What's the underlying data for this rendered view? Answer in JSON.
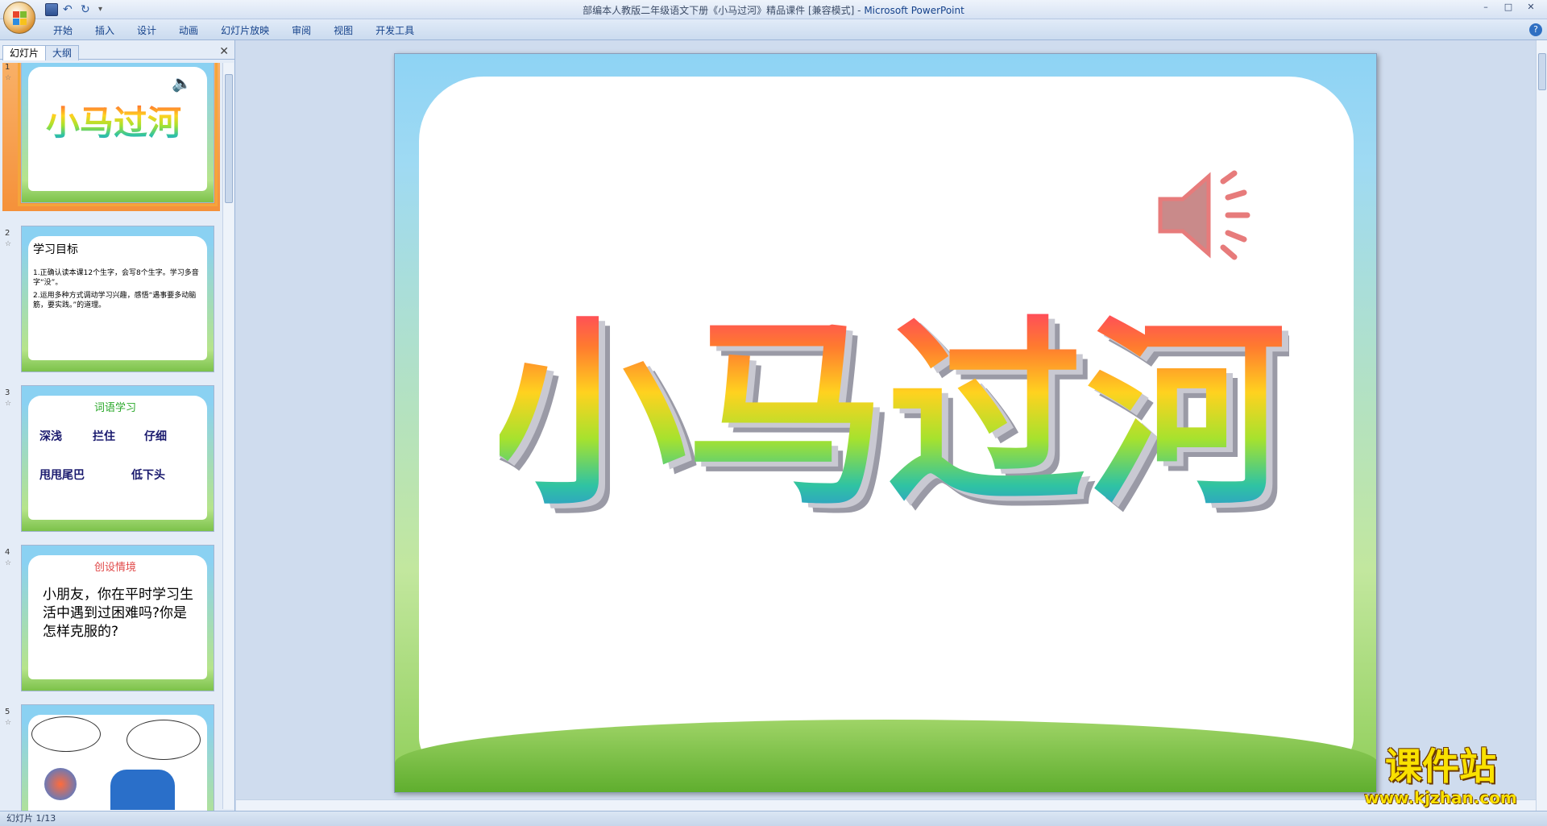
{
  "window": {
    "title": "部编本人教版二年级语文下册《小马过河》精品课件 [兼容模式] - ",
    "app_name": "Microsoft PowerPoint",
    "controls": [
      "–",
      "□",
      "✕"
    ]
  },
  "ribbon": {
    "tabs": [
      "开始",
      "插入",
      "设计",
      "动画",
      "幻灯片放映",
      "审阅",
      "视图",
      "开发工具"
    ],
    "help": "?"
  },
  "left_pane": {
    "tabs": [
      "幻灯片",
      "大纲"
    ],
    "close": "✕",
    "slides": [
      {
        "num": "1",
        "title": "小马过河"
      },
      {
        "num": "2",
        "title": "学习目标",
        "lines": [
          "1.正确认读本课12个生字，会写8个生字。学习多音字“没”。",
          "2.运用多种方式调动学习兴趣，感悟“遇事要多动脑筋，要实践。”的道理。"
        ]
      },
      {
        "num": "3",
        "title": "词语学习",
        "words_row1": [
          "深浅",
          "拦住",
          "仔细"
        ],
        "words_row2": [
          "甩甩尾巴",
          "低下头"
        ]
      },
      {
        "num": "4",
        "title": "创设情境",
        "body": "小朋友，你在平时学习生活中遇到过困难吗?你是怎样克服的?"
      },
      {
        "num": "5"
      }
    ]
  },
  "slide": {
    "title": "小马过河",
    "rainbow_colors": [
      "#ff3b6b",
      "#ff7a2f",
      "#ffd21f",
      "#a6e22e",
      "#2fc3a3",
      "#2f7fe8"
    ]
  },
  "status": {
    "text": "幻灯片 1/13"
  },
  "watermark": {
    "big": "课件站",
    "small": "www.kjzhan.com"
  }
}
